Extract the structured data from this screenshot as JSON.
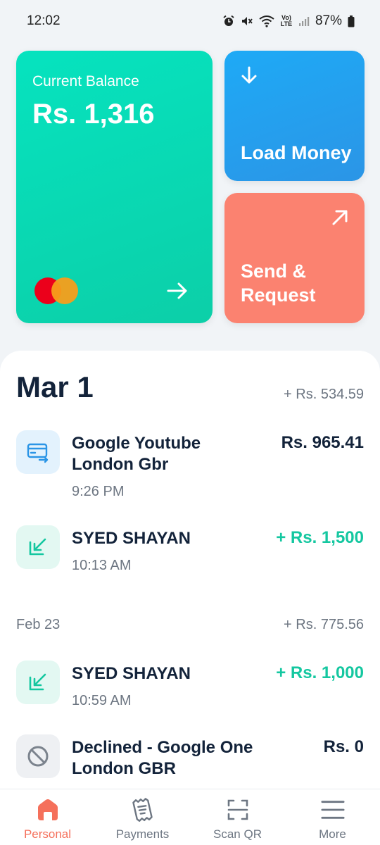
{
  "status_bar": {
    "time": "12:02",
    "battery": "87%",
    "icons": [
      "alarm-icon",
      "mute-icon",
      "wifi-icon",
      "volte-icon",
      "signal-icon",
      "battery-icon"
    ],
    "volte_label": "Vo) LTE"
  },
  "balance_card": {
    "label": "Current Balance",
    "value": "Rs. 1,316",
    "logo": "mastercard-logo",
    "arrow_icon": "arrow-right-icon"
  },
  "actions": {
    "load_money": {
      "label": "Load Money",
      "icon": "arrow-down-icon",
      "color": "#2b9bec"
    },
    "send_request": {
      "label": "Send & Request",
      "icon": "arrow-up-right-icon",
      "color": "#fb8270"
    }
  },
  "transactions": {
    "groups": [
      {
        "date": "Mar 1",
        "total": "+ Rs. 534.59",
        "items": [
          {
            "title": "Google Youtube London Gbr",
            "time": "9:26 PM",
            "amount": "Rs. 965.41",
            "type": "debit",
            "icon": "card-transfer-icon"
          },
          {
            "title": "SYED SHAYAN",
            "time": "10:13 AM",
            "amount": "+ Rs. 1,500",
            "type": "credit",
            "icon": "receive-arrow-icon"
          }
        ]
      },
      {
        "date": "Feb 23",
        "total": "+ Rs. 775.56",
        "items": [
          {
            "title": "SYED SHAYAN",
            "time": "10:59 AM",
            "amount": "+ Rs. 1,000",
            "type": "credit",
            "icon": "receive-arrow-icon"
          },
          {
            "title": "Declined - Google One London GBR",
            "time": "",
            "amount": "Rs. 0",
            "type": "declined",
            "icon": "declined-icon"
          }
        ]
      }
    ]
  },
  "bottom_nav": {
    "items": [
      {
        "label": "Personal",
        "icon": "home-icon",
        "active": true
      },
      {
        "label": "Payments",
        "icon": "receipt-icon",
        "active": false
      },
      {
        "label": "Scan QR",
        "icon": "scan-qr-icon",
        "active": false
      },
      {
        "label": "More",
        "icon": "menu-icon",
        "active": false
      }
    ],
    "accent": "#f5705b"
  },
  "colors": {
    "balance_card": "#0ad9b4",
    "credit_text": "#14c7a0",
    "primary_text": "#13233a",
    "secondary_text": "#6d7682"
  }
}
